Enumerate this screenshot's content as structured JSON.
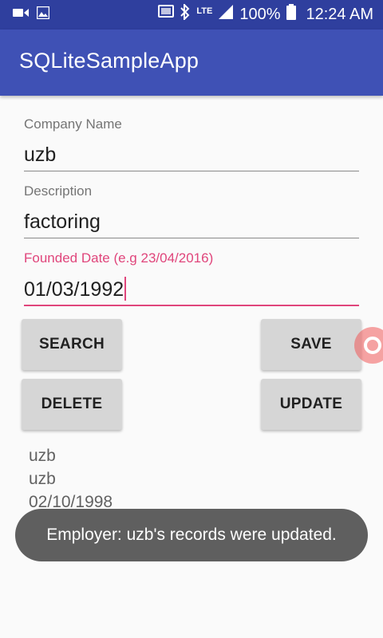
{
  "status_bar": {
    "battery": "100%",
    "time": "12:24 AM",
    "network": "LTE",
    "icons": [
      "video-icon",
      "image-icon",
      "cast-icon",
      "bluetooth-icon",
      "lte-icon",
      "signal-icon",
      "battery-icon"
    ]
  },
  "app_bar": {
    "title": "SQLiteSampleApp",
    "color": "#3f51b5"
  },
  "form": {
    "company_name": {
      "label": "Company Name",
      "value": "uzb"
    },
    "description": {
      "label": "Description",
      "value": "factoring"
    },
    "founded_date": {
      "label": "Founded Date (e.g 23/04/2016)",
      "value": "01/03/1992"
    }
  },
  "buttons": {
    "search": "SEARCH",
    "save": "SAVE",
    "delete": "DELETE",
    "update": "UPDATE"
  },
  "results": [
    "uzb",
    "uzb",
    "02/10/1998"
  ],
  "toast": {
    "message": "Employer: uzb's records were updated."
  },
  "colors": {
    "primary": "#3f51b5",
    "primary_dark": "#2f3f9e",
    "accent": "#e0457b"
  }
}
